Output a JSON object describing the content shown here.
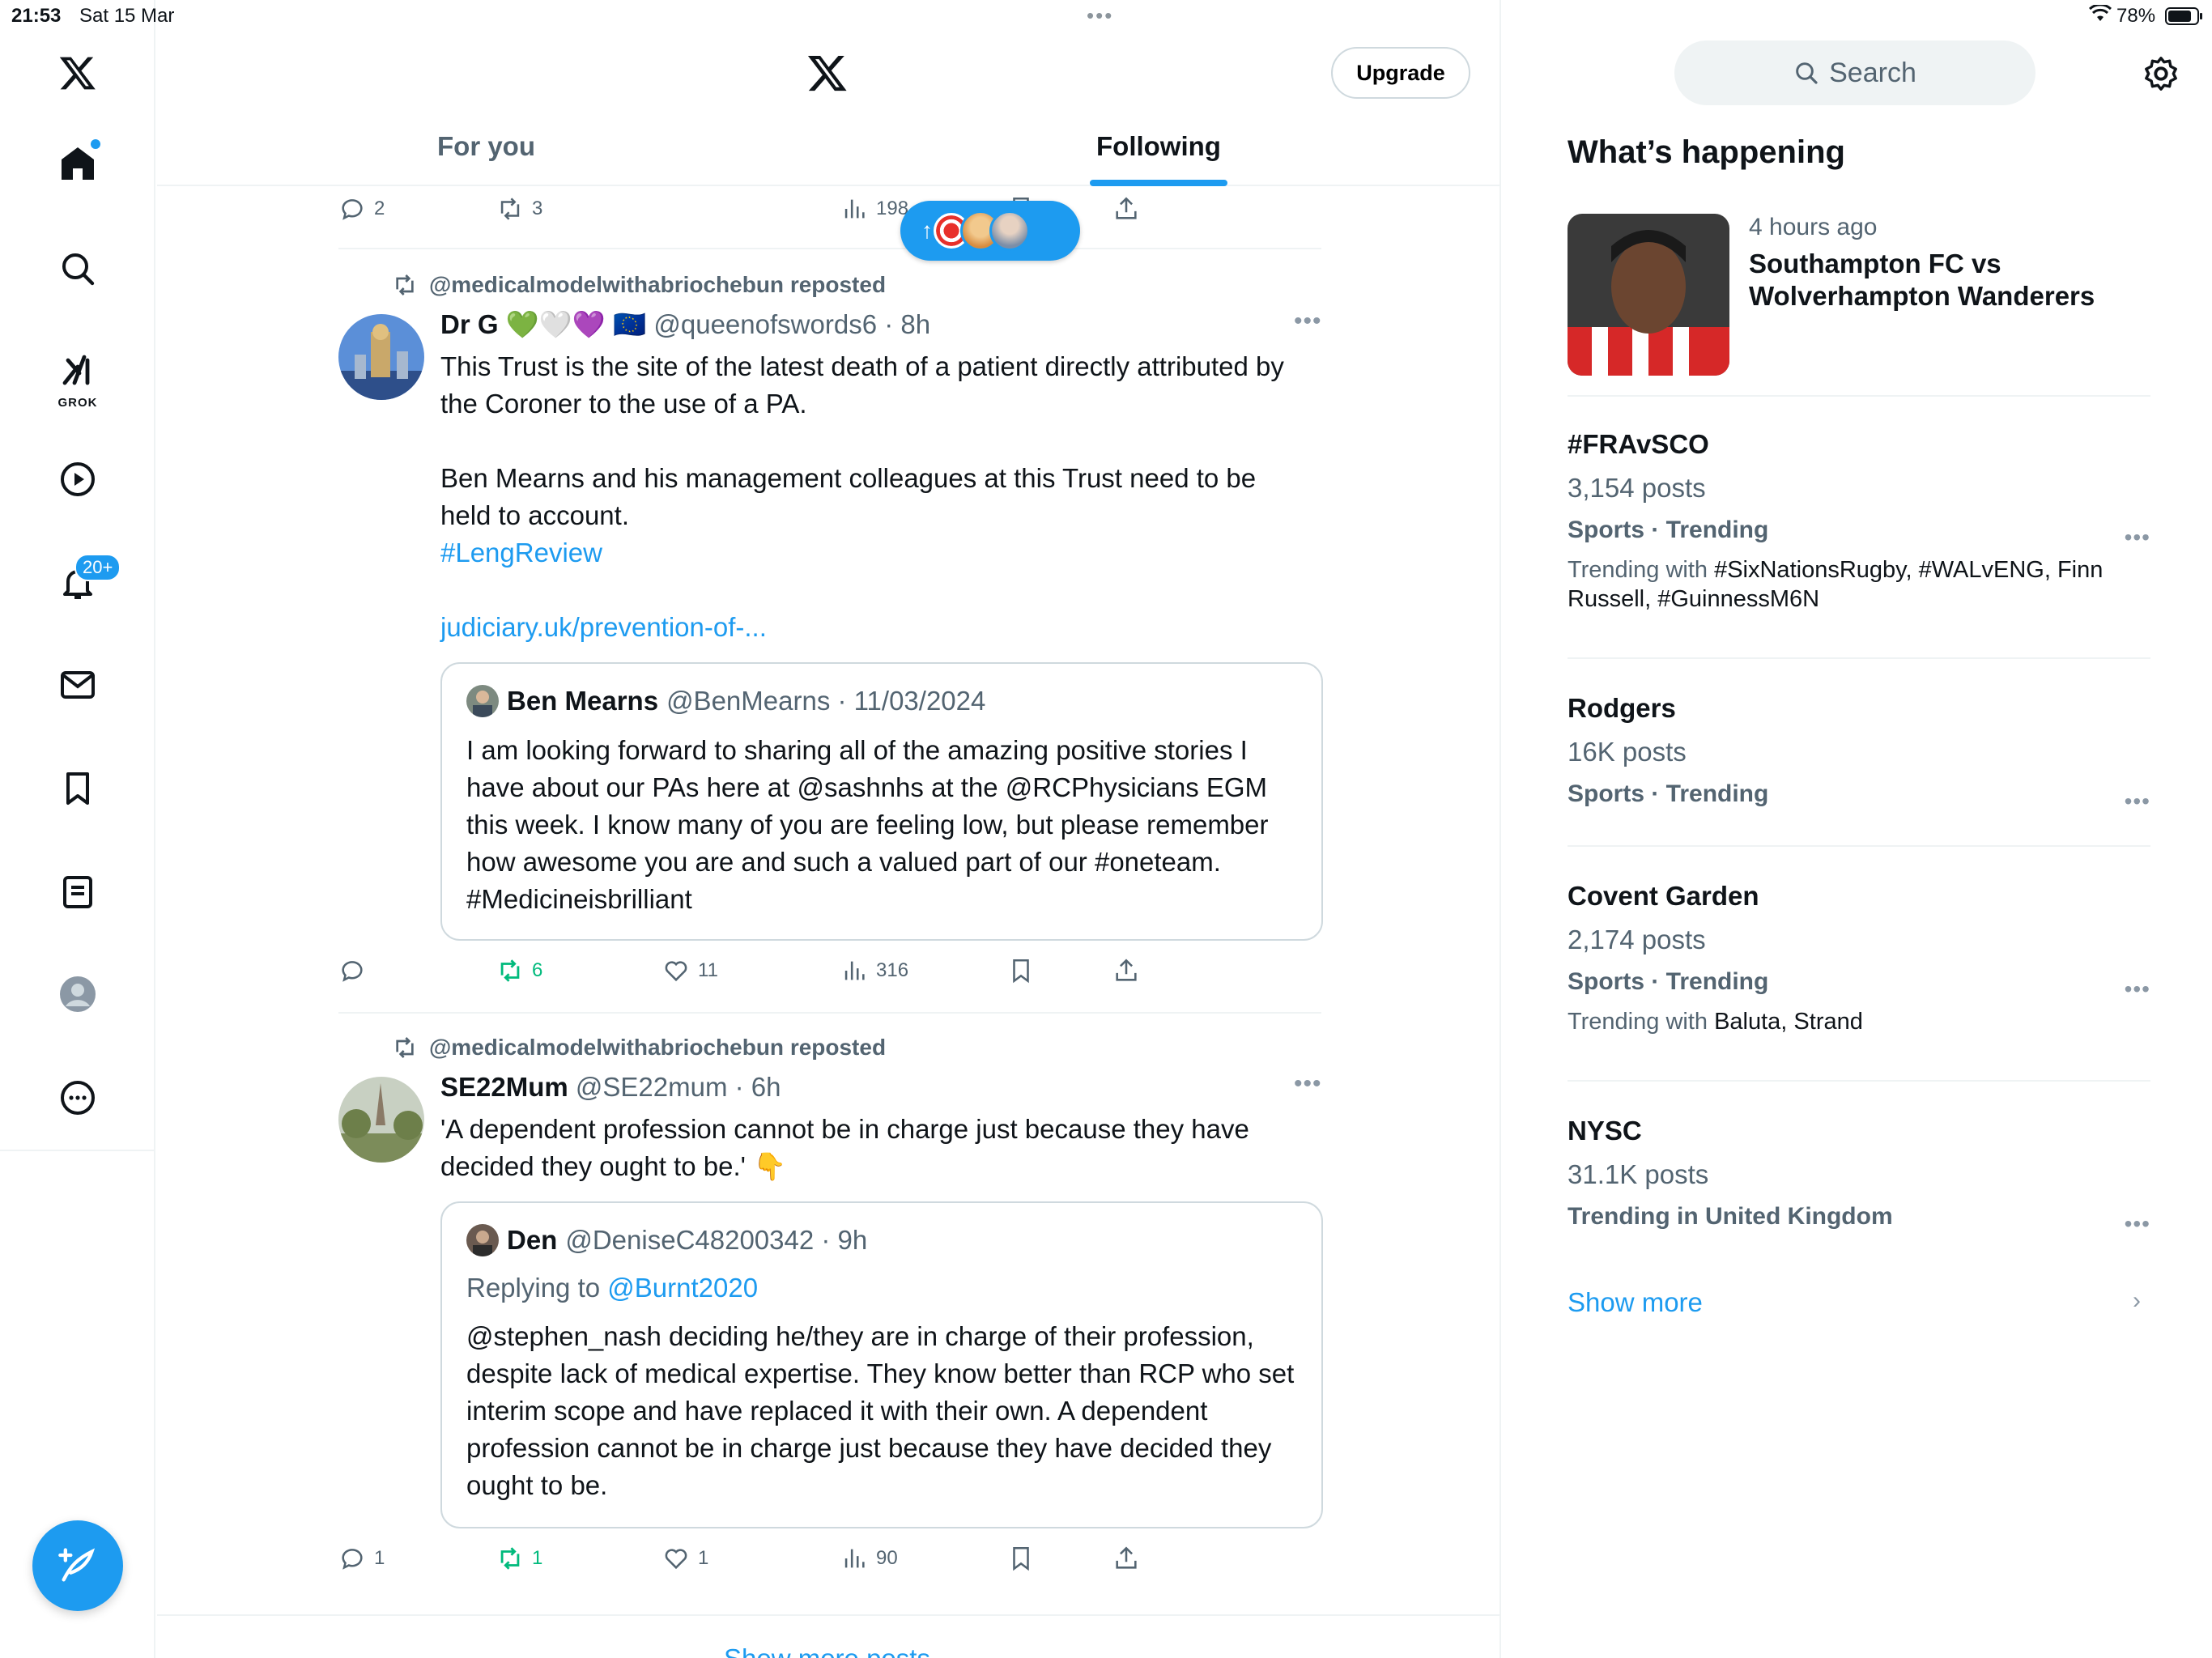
{
  "status_bar": {
    "time": "21:53",
    "date": "Sat 15 Mar",
    "battery": "78%"
  },
  "sidebar": {
    "items": [
      "x-logo",
      "home",
      "explore",
      "grok",
      "videos",
      "notifications",
      "messages",
      "bookmarks",
      "lists",
      "profile",
      "more"
    ],
    "grok_label": "GROK",
    "notifications_badge": "20+"
  },
  "header": {
    "upgrade_label": "Upgrade",
    "tabs": [
      {
        "label": "For you",
        "active": false
      },
      {
        "label": "Following",
        "active": true
      }
    ]
  },
  "top_actions": {
    "replies": "2",
    "reposts": "3",
    "views": "198"
  },
  "tweets": [
    {
      "reposted_by": "@medicalmodelwithabriochebun reposted",
      "name": "Dr G 💚🤍💜 🇪🇺",
      "handle_time": "@queenofswords6 · 8h",
      "text_1": "This Trust is the site of the latest death of a patient directly attributed by the Coroner to the use of a PA.",
      "text_2": "Ben Mearns and his management colleagues at this Trust need to be held to account.",
      "hashtag": "#LengReview",
      "link": "judiciary.uk/prevention-of-...",
      "quote": {
        "name": "Ben Mearns",
        "handle_time": "@BenMearns · 11/03/2024",
        "text": "I am looking forward to sharing all of the amazing positive stories I have about our PAs here at @sashnhs at the @RCPhysicians EGM this week. I know many of you are feeling low, but please remember how awesome you are and such a valued part of our #oneteam. #Medicineisbrilliant"
      },
      "actions": {
        "replies": "",
        "reposts": "6",
        "likes": "11",
        "views": "316"
      }
    },
    {
      "reposted_by": "@medicalmodelwithabriochebun reposted",
      "name": "SE22Mum",
      "handle_time": "@SE22mum · 6h",
      "text": "'A dependent profession cannot be in charge just because they have decided they ought to be.' 👇",
      "quote": {
        "name": "Den",
        "handle_time": "@DeniseC48200342 · 9h",
        "replying_prefix": "Replying to ",
        "replying_to": "@Burnt2020",
        "text": "@stephen_nash deciding he/they are in charge of their profession, despite lack of medical expertise. They know better than RCP who set interim scope and have replaced it with their own. A dependent profession cannot be in charge just because they have decided they ought to be."
      },
      "actions": {
        "replies": "1",
        "reposts": "1",
        "likes": "1",
        "views": "90"
      }
    }
  ],
  "bottom_partial": "Show more posts",
  "right": {
    "search_placeholder": "Search",
    "whats_happening": "What’s happening",
    "news": {
      "meta": "4 hours ago",
      "title": "Southampton FC vs Wolverhampton Wanderers"
    },
    "trends": [
      {
        "name": "#FRAvSCO",
        "count": "3,154 posts",
        "category": "Sports · Trending",
        "with_label": "Trending with ",
        "with": "#SixNationsRugby, #WALvENG, Finn Russell, #GuinnessM6N"
      },
      {
        "name": "Rodgers",
        "count": "16K posts",
        "category": "Sports · Trending"
      },
      {
        "name": "Covent Garden",
        "count": "2,174 posts",
        "category": "Sports · Trending",
        "with_label": "Trending with ",
        "with": "Baluta, Strand"
      },
      {
        "name": "NYSC",
        "count": "31.1K posts",
        "category": "Trending in United Kingdom"
      }
    ],
    "show_more": "Show more"
  },
  "colors": {
    "accent": "#1d9bf0",
    "repost_green": "#00ba7c",
    "secondary_text": "#536471"
  }
}
